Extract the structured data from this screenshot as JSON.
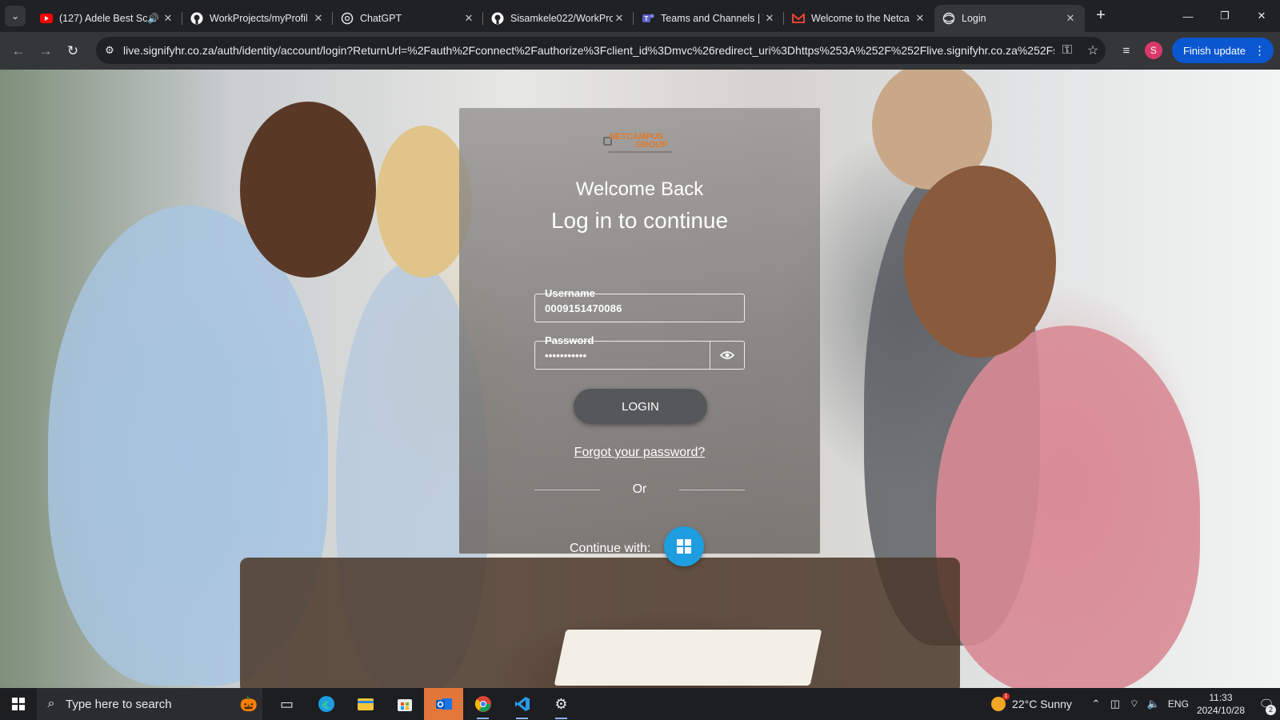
{
  "browser": {
    "tabs": [
      {
        "title": "(127) Adele Best Sc",
        "favicon": "youtube-icon",
        "audio": true
      },
      {
        "title": "WorkProjects/myProfil",
        "favicon": "github-icon"
      },
      {
        "title": "ChatGPT",
        "favicon": "chatgpt-icon"
      },
      {
        "title": "Sisamkele022/WorkPro",
        "favicon": "github-icon"
      },
      {
        "title": "Teams and Channels | T",
        "favicon": "teams-icon"
      },
      {
        "title": "Welcome to the Netca",
        "favicon": "gmail-icon"
      },
      {
        "title": "Login",
        "favicon": "globe-icon",
        "active": true
      }
    ],
    "url": "live.signifyhr.co.za/auth/identity/account/login?ReturnUrl=%2Fauth%2Fconnect%2Fauthorize%3Fclient_id%3Dmvc%26redirect_uri%3Dhttps%253A%252F%252Flive.signifyhr.co.za%252Fsig...",
    "profile_initial": "S",
    "finish_update_label": "Finish update"
  },
  "login": {
    "logo_line1": "NETCAMPUS",
    "logo_line2": "GROUP",
    "welcome": "Welcome Back",
    "subtitle": "Log in to continue",
    "username_label": "Username",
    "username_value": "0009151470086",
    "password_label": "Password",
    "password_value": "•••••••••••",
    "login_button": "LOGIN",
    "forgot_link": "Forgot your password?",
    "or_text": "Or",
    "continue_with": "Continue with:",
    "ms_button": "windows-icon"
  },
  "taskbar": {
    "search_placeholder": "Type here to search",
    "weather_temp": "22°C",
    "weather_desc": "Sunny",
    "weather_badge": "1",
    "language": "ENG",
    "time": "11:33",
    "date": "2024/10/28",
    "notification_count": "2"
  }
}
